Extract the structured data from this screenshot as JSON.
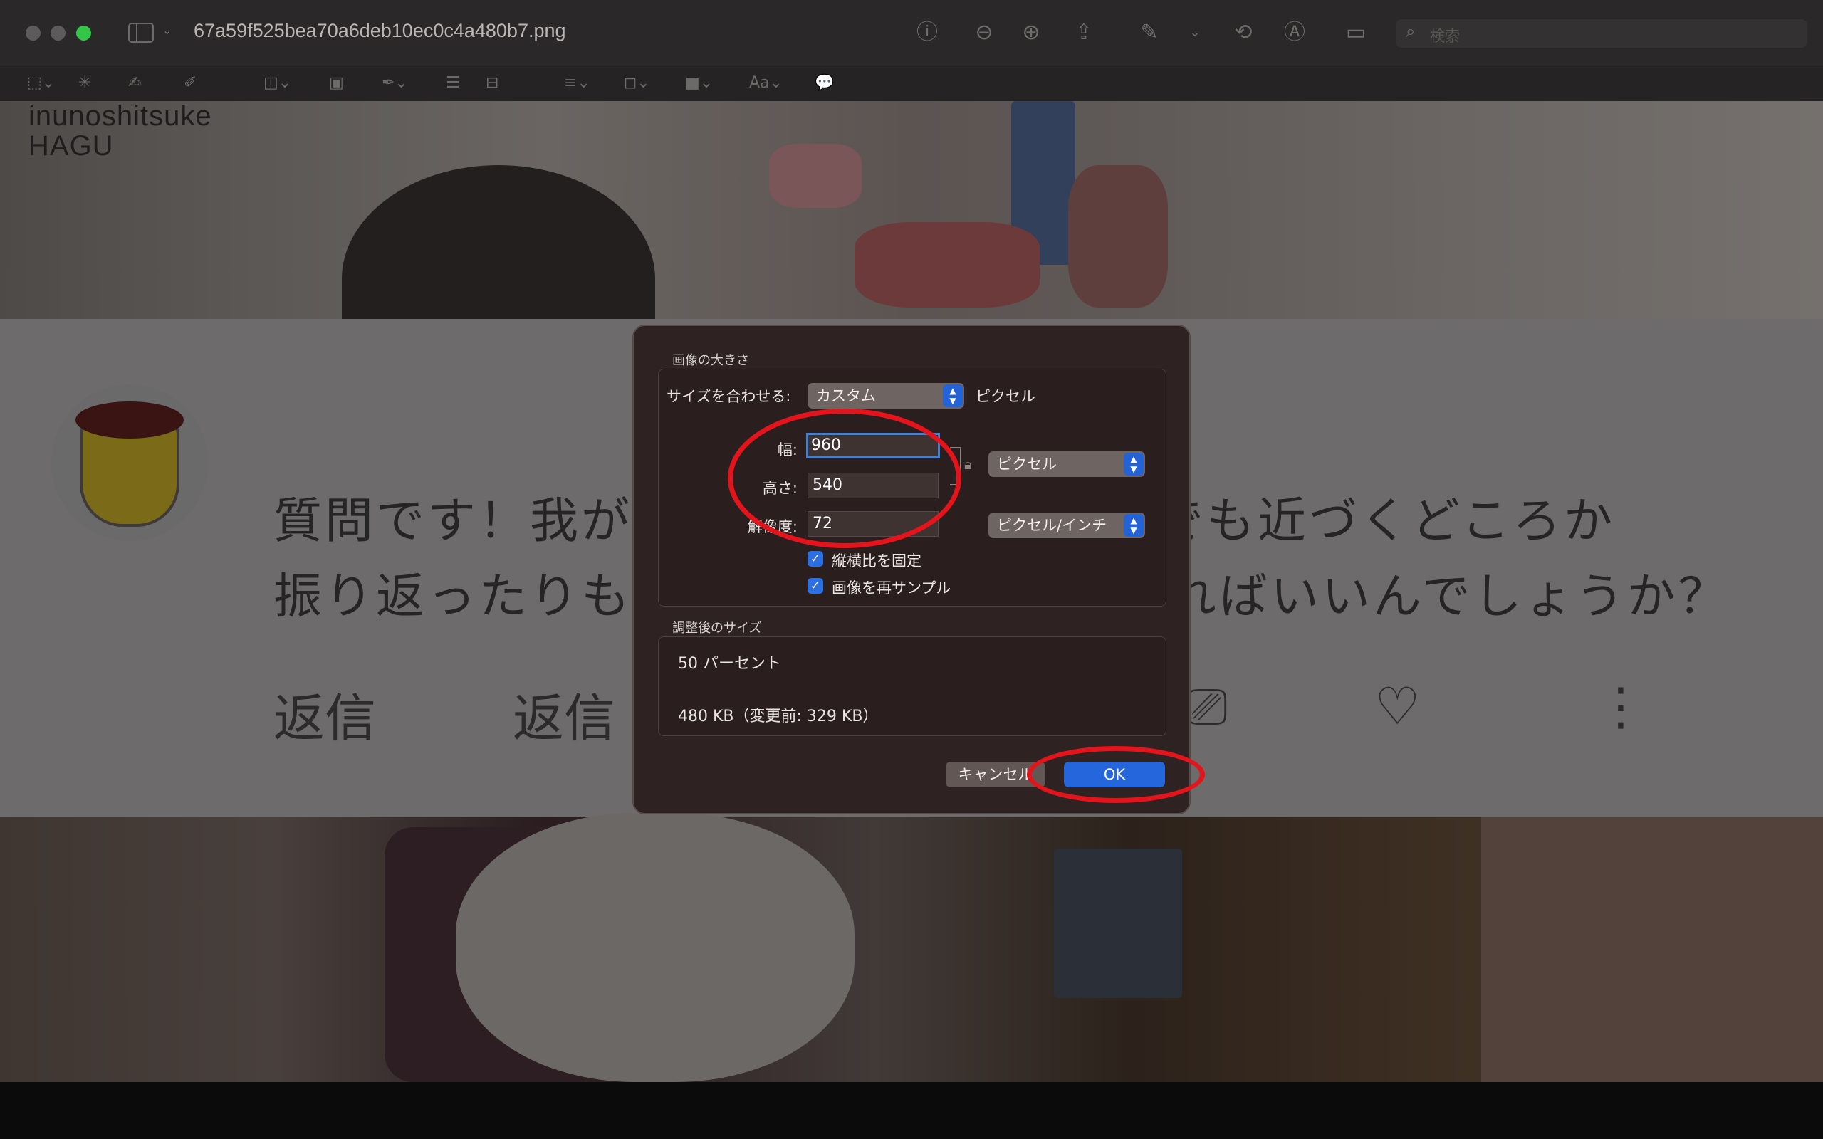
{
  "window": {
    "title": "67a59f525bea70a6deb10ec0c4a480b7.png",
    "search_placeholder": "検索"
  },
  "toolbar": {
    "tools": [
      "selection-tool",
      "instant-alpha-tool",
      "sketch-tool",
      "draw-tool",
      "shapes-tool",
      "text-tool",
      "sign-tool",
      "adjust-color-tool",
      "adjust-size-tool",
      "shape-style-tool",
      "border-color-tool",
      "fill-color-tool",
      "text-style-tool",
      "annotate-tool"
    ],
    "text_style_label": "Aa"
  },
  "background": {
    "logo_line1": "inunoshitsuke",
    "logo_line2": "HAGU",
    "line1_left": "質問です！我が",
    "line1_right": "でも近づくどころか",
    "line2_left": "振り返ったりも",
    "line2_right": "ればいいんでしょうか？",
    "reply1": "返信",
    "reply2": "返信"
  },
  "dialog": {
    "section_title": "画像の大きさ",
    "fit_label": "サイズを合わせる:",
    "fit_value": "カスタム",
    "fit_unit": "ピクセル",
    "width_label": "幅:",
    "width_value": "960",
    "height_label": "高さ:",
    "height_value": "540",
    "resolution_label": "解像度:",
    "resolution_value": "72",
    "size_unit": "ピクセル",
    "resolution_unit": "ピクセル/インチ",
    "scale_proportionally": "縦横比を固定",
    "resample": "画像を再サンプル",
    "result_title": "調整後のサイズ",
    "result_percent": "50 パーセント",
    "result_size": "480 KB（変更前: 329 KB）",
    "cancel_label": "キャンセル",
    "ok_label": "OK"
  },
  "colors": {
    "annotation": "#e3141b",
    "accent": "#2566dc",
    "traffic_max": "#34c549"
  }
}
